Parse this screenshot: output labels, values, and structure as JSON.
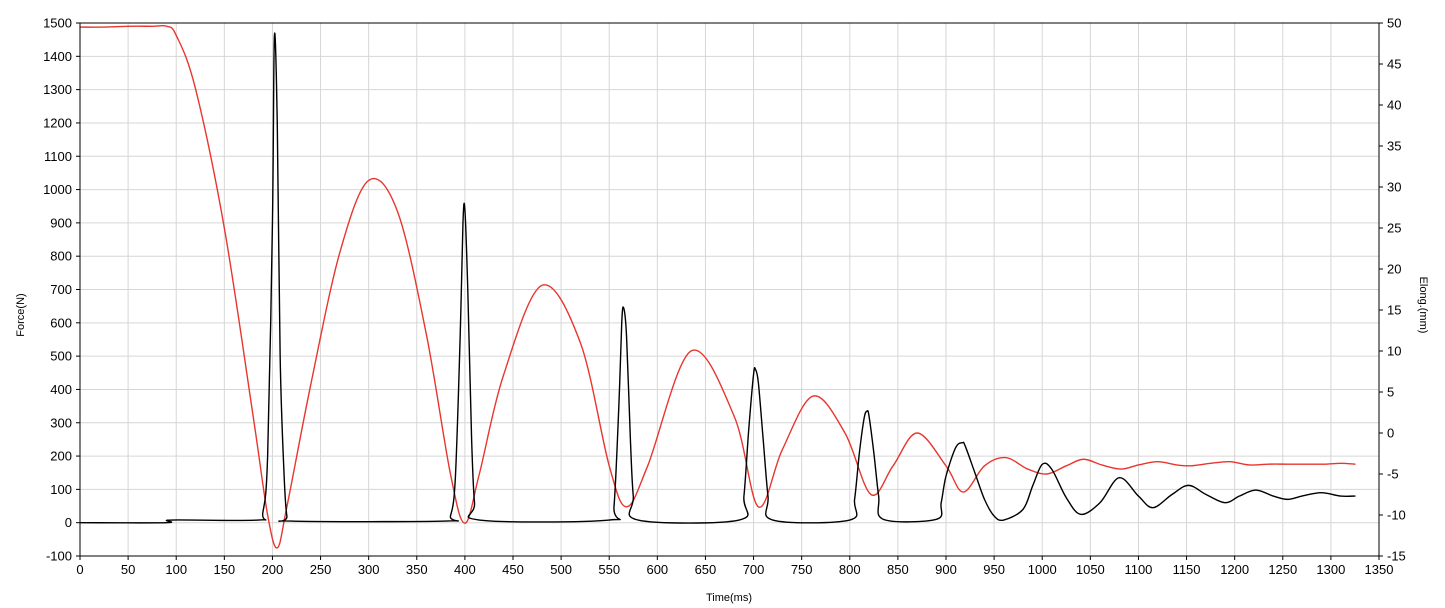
{
  "chart_data": {
    "type": "line",
    "title": "",
    "xlabel": "Time(ms)",
    "ylabel_left": "Force(N)",
    "ylabel_right": "Elong.(mm)",
    "xlim": [
      0,
      1350
    ],
    "ylim_left": [
      -100,
      1500
    ],
    "ylim_right": [
      -15,
      50
    ],
    "x_ticks": [
      0,
      50,
      100,
      150,
      200,
      250,
      300,
      350,
      400,
      450,
      500,
      550,
      600,
      650,
      700,
      750,
      800,
      850,
      900,
      950,
      1000,
      1050,
      1100,
      1150,
      1200,
      1250,
      1300,
      1350
    ],
    "y_left_ticks": [
      -100,
      0,
      100,
      200,
      300,
      400,
      500,
      600,
      700,
      800,
      900,
      1000,
      1100,
      1200,
      1300,
      1400,
      1500
    ],
    "y_right_ticks": [
      -15,
      -10,
      -5,
      0,
      5,
      10,
      15,
      20,
      25,
      30,
      35,
      40,
      45,
      50
    ],
    "grid": true,
    "legend": "none",
    "colors": {
      "force": "#000000",
      "elongation": "#e8362f",
      "grid": "#d6d6d6"
    },
    "series": [
      {
        "axis": "left",
        "color": "#000000",
        "x": [
          0,
          90,
          95,
          185,
          190,
          195,
          200,
          202,
          205,
          208,
          212,
          215,
          220,
          380,
          385,
          390,
          395,
          398,
          400,
          403,
          407,
          410,
          415,
          550,
          555,
          560,
          563,
          565,
          568,
          572,
          575,
          580,
          685,
          690,
          695,
          700,
          702,
          705,
          710,
          715,
          720,
          800,
          805,
          810,
          815,
          818,
          820,
          825,
          830,
          835,
          890,
          895,
          900,
          910,
          917,
          920,
          930,
          940,
          950,
          960,
          980,
          990,
          1000,
          1010,
          1025,
          1040,
          1060,
          1080,
          1100,
          1115,
          1135,
          1152,
          1170,
          1190,
          1205,
          1222,
          1240,
          1255,
          1270,
          1290,
          1310,
          1325
        ],
        "y": [
          0,
          0,
          8,
          8,
          30,
          200,
          900,
          1460,
          1200,
          500,
          150,
          20,
          5,
          5,
          20,
          130,
          550,
          900,
          940,
          700,
          250,
          60,
          8,
          8,
          50,
          350,
          600,
          645,
          560,
          250,
          80,
          8,
          8,
          80,
          280,
          445,
          460,
          420,
          250,
          80,
          8,
          8,
          70,
          210,
          315,
          335,
          320,
          210,
          80,
          10,
          10,
          60,
          140,
          225,
          240,
          230,
          150,
          70,
          20,
          8,
          40,
          110,
          175,
          160,
          75,
          25,
          60,
          135,
          80,
          45,
          85,
          112,
          85,
          60,
          80,
          98,
          80,
          70,
          80,
          90,
          80,
          80
        ]
      },
      {
        "axis": "right",
        "color": "#e8362f",
        "x": [
          0,
          25,
          50,
          75,
          90,
          100,
          120,
          150,
          180,
          195,
          205,
          215,
          240,
          270,
          300,
          330,
          360,
          385,
          400,
          415,
          440,
          480,
          520,
          550,
          568,
          590,
          635,
          680,
          705,
          730,
          762,
          795,
          822,
          845,
          870,
          900,
          918,
          940,
          962,
          985,
          1005,
          1025,
          1043,
          1062,
          1082,
          1100,
          1120,
          1140,
          1155,
          1175,
          1195,
          1215,
          1235,
          1255,
          1275,
          1295,
          1310,
          1325
        ],
        "y": [
          49.5,
          49.5,
          49.6,
          49.6,
          49.6,
          48.5,
          42,
          25,
          2,
          -10,
          -14,
          -9,
          6,
          22,
          30.8,
          27,
          12,
          -5,
          -11,
          -5,
          7,
          18,
          11,
          -4,
          -9,
          -4,
          10,
          2,
          -9,
          -2,
          4.5,
          0,
          -7.5,
          -4,
          0,
          -4,
          -7.2,
          -4,
          -3,
          -4.4,
          -5,
          -4,
          -3.2,
          -3.9,
          -4.4,
          -3.9,
          -3.5,
          -3.9,
          -4,
          -3.7,
          -3.5,
          -3.9,
          -3.8,
          -3.8,
          -3.8,
          -3.8,
          -3.7,
          -3.8
        ]
      }
    ]
  }
}
